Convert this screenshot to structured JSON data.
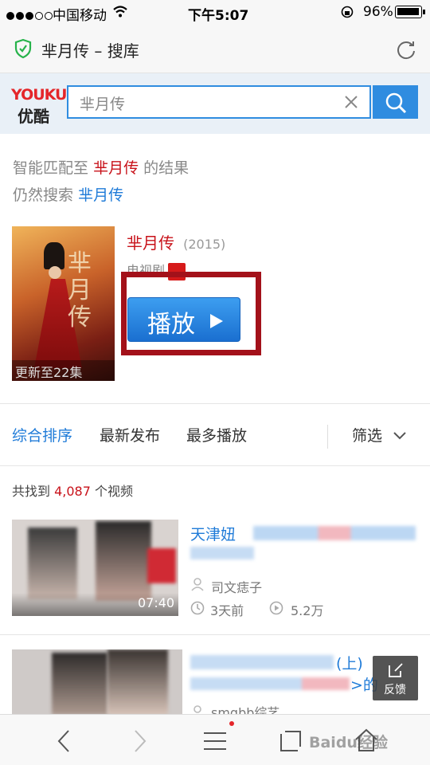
{
  "status_bar": {
    "carrier": "中国移动",
    "time": "下午5:07",
    "battery": "96%"
  },
  "address_bar": {
    "title": "芈月传 – 搜库",
    "icons": [
      "shield-icon",
      "refresh-icon"
    ]
  },
  "search": {
    "logo_latin": "YOUKU",
    "logo_cn": "优酷",
    "query": "芈月传"
  },
  "match": {
    "prefix": "智能匹配至",
    "term": "芈月传",
    "suffix": "的结果",
    "still_prefix": "仍然搜索",
    "still_term": "芈月传"
  },
  "show": {
    "title": "芈月传",
    "year": "(2015)",
    "category": "电视剧",
    "poster_caption": "更新至22集",
    "play_label": "播放"
  },
  "filter_tabs": {
    "items": [
      "综合排序",
      "最新发布",
      "最多播放"
    ],
    "filter_label": "筛选"
  },
  "results": {
    "count_prefix": "共找到",
    "count": "4,087",
    "count_suffix": "个视频"
  },
  "videos": [
    {
      "title_start": "天津妞",
      "duration": "07:40",
      "uploader": "司文痣子",
      "time_ago": "3天前",
      "plays": "5.2万"
    },
    {
      "title_part": "(上)",
      "title_end": ">的",
      "uploader": "smgbb综艺"
    }
  ],
  "feedback_label": "反馈",
  "watermark": "Baidu经验",
  "colors": {
    "accent_blue": "#1f7bd8",
    "search_blue": "#2f8ce0",
    "highlight_red": "#c8121a",
    "box_red": "#a3111a"
  }
}
